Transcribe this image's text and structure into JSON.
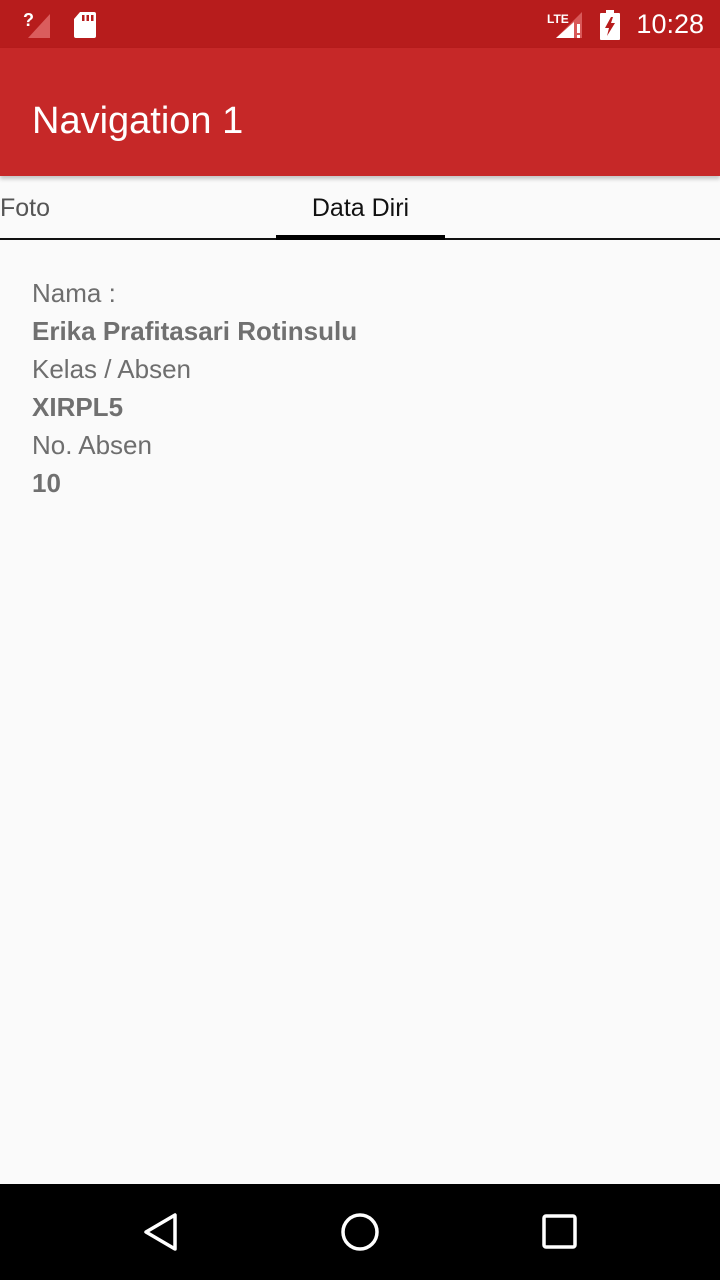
{
  "status_bar": {
    "time": "10:28",
    "icons": [
      "signal-unknown-icon",
      "sd-card-icon",
      "lte-signal-alert-icon",
      "battery-charging-icon"
    ]
  },
  "app_bar": {
    "title": "Navigation 1"
  },
  "tabs": [
    {
      "label": "Foto",
      "selected": false
    },
    {
      "label": "Data Diri",
      "selected": true
    }
  ],
  "profile": {
    "name_label": "Nama :",
    "name_value": "Erika Prafitasari Rotinsulu",
    "class_label": "Kelas / Absen",
    "class_value": "XIRPL5",
    "number_label": "No. Absen",
    "number_value": "10"
  },
  "nav_bar": {
    "buttons": [
      "back-icon",
      "home-icon",
      "recents-icon"
    ]
  },
  "colors": {
    "status_bar": "#b71c1c",
    "app_bar": "#c62828",
    "background": "#fafafa"
  }
}
